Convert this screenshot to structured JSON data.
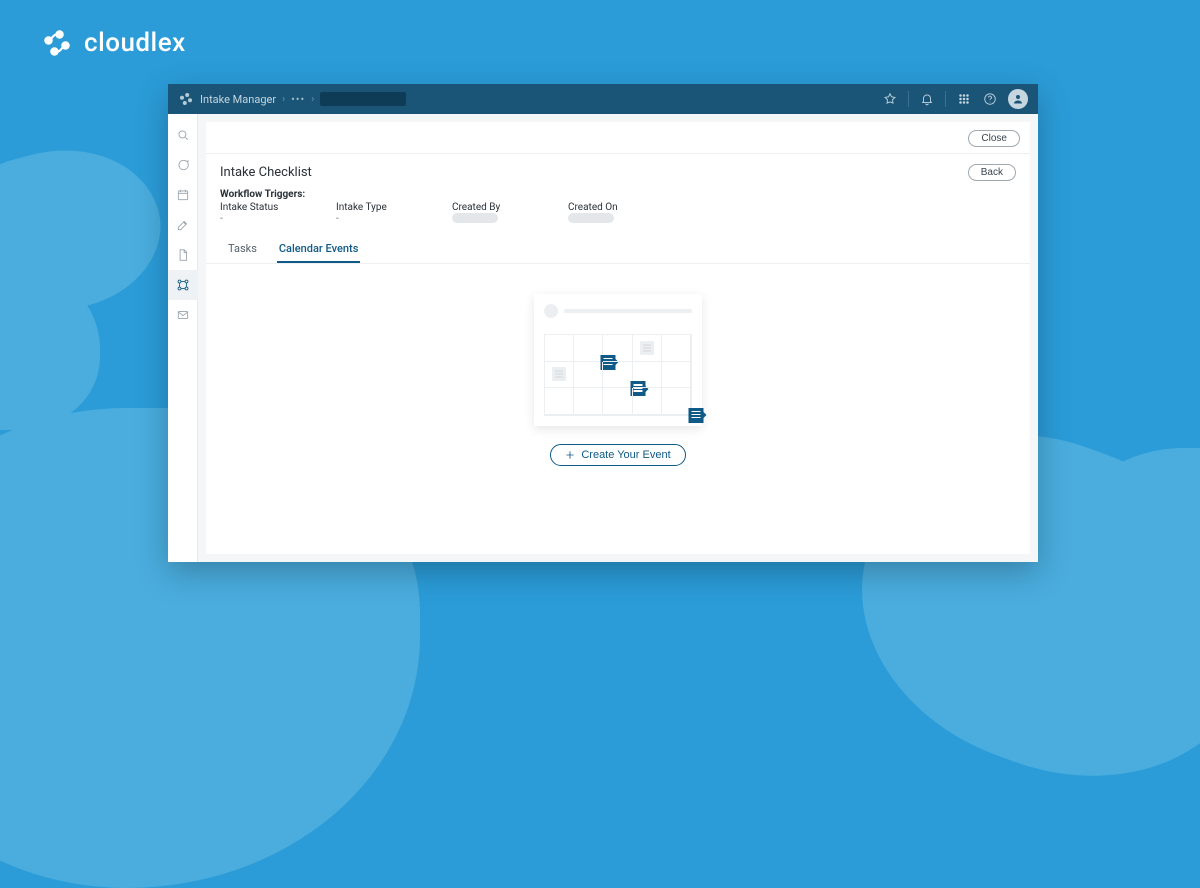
{
  "brand": {
    "name": "cloudlex"
  },
  "titlebar": {
    "app_title": "Intake Manager"
  },
  "content": {
    "close_label": "Close",
    "back_label": "Back",
    "heading": "Intake Checklist",
    "triggers_title": "Workflow Triggers:",
    "triggers": [
      {
        "label": "Intake Status",
        "value": "-"
      },
      {
        "label": "Intake Type",
        "value": "-"
      },
      {
        "label": "Created By",
        "value": ""
      },
      {
        "label": "Created On",
        "value": ""
      }
    ],
    "tabs": {
      "tasks": "Tasks",
      "calendar": "Calendar Events"
    },
    "create_event_label": "Create Your Event"
  }
}
